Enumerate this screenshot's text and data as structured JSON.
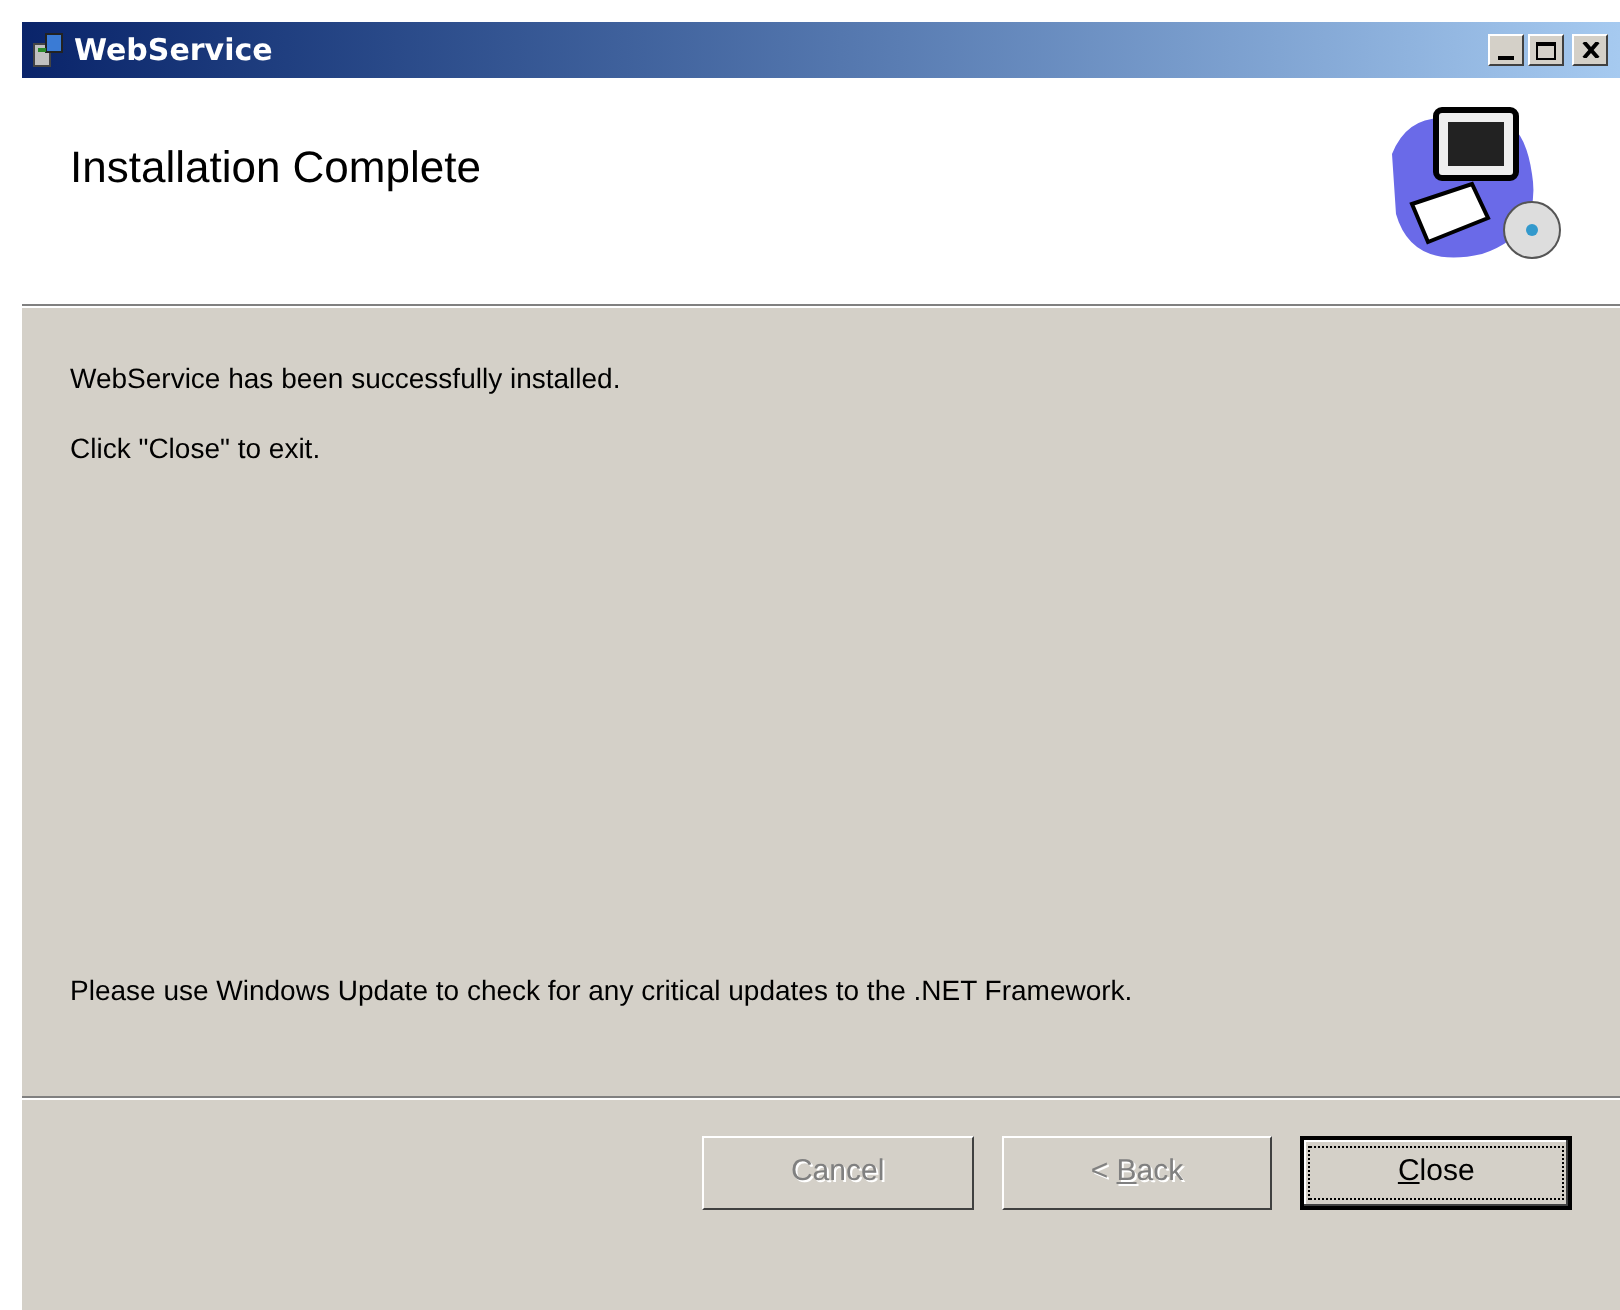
{
  "window": {
    "title": "WebService"
  },
  "header": {
    "title": "Installation Complete"
  },
  "messages": [
    {
      "text": "WebService has been successfully installed."
    },
    {
      "text": "Click \"Close\" to exit."
    }
  ],
  "footer_note": "Please use Windows Update to check for any critical updates to the .NET Framework.",
  "buttons": [
    {
      "after": "Cancel",
      "disabled": true,
      "focused": false
    },
    {
      "before": "< ",
      "access_key": "B",
      "after": "ack",
      "disabled": true,
      "focused": false
    },
    {
      "access_key": "C",
      "after": "lose",
      "disabled": false,
      "focused": true
    }
  ]
}
